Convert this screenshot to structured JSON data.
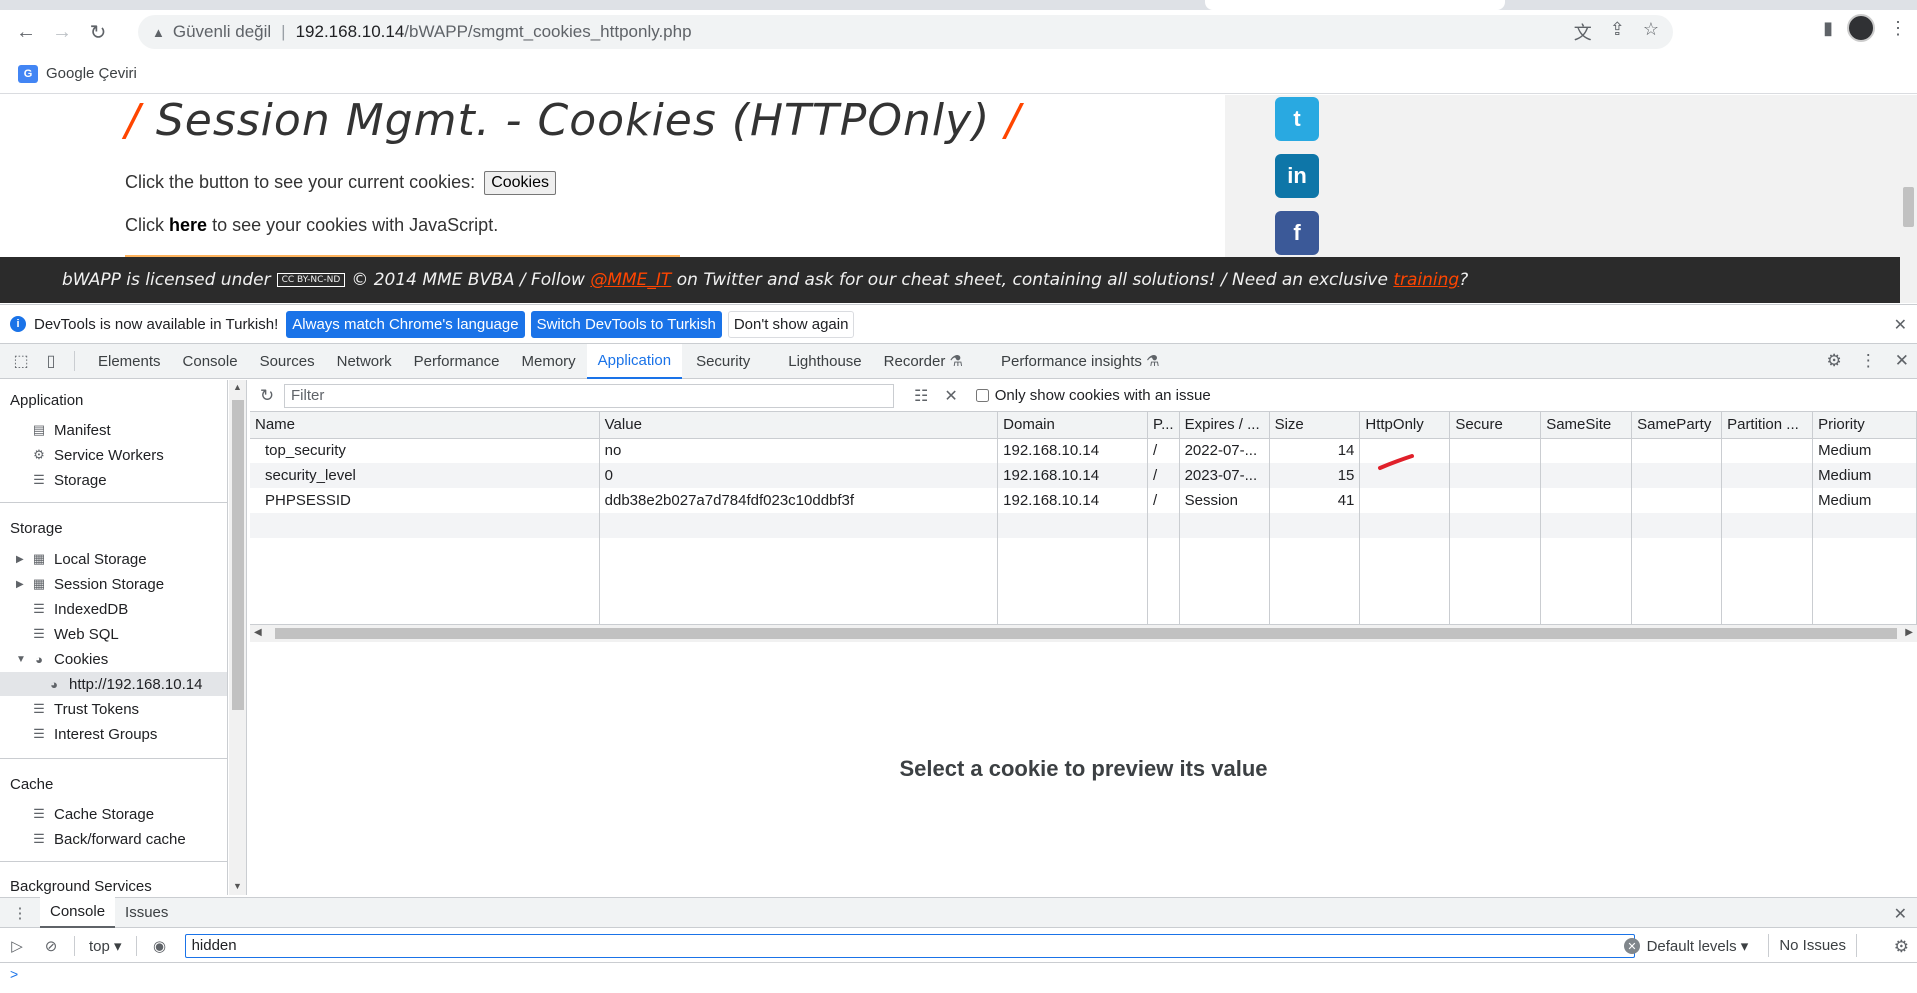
{
  "browser": {
    "security_label": "Güvenli değil",
    "separator": "|",
    "url_host": "192.168.10.14",
    "url_path": "/bWAPP/smgmt_cookies_httponly.php",
    "bookmark": "Google Çeviri",
    "icons": [
      "back-icon",
      "forward-icon",
      "reload-icon",
      "warning-icon",
      "translate-icon",
      "share-icon",
      "star-icon",
      "sidepanel-icon",
      "avatar",
      "menu-icon"
    ]
  },
  "page": {
    "title_slash_left": "/",
    "title": "Session Mgmt. - Cookies (HTTPOnly)",
    "title_slash_right": "/",
    "line1_text": "Click the button to see your current cookies:",
    "cookies_button": "Cookies",
    "line2_pre": "Click",
    "line2_link": "here",
    "line2_post": "to see your cookies with JavaScript.",
    "social": {
      "twitter": "t",
      "linkedin": "in",
      "facebook": "f"
    },
    "footer": {
      "pre": "bWAPP is licensed under",
      "cc": "CC BY-NC-ND",
      "mid": "© 2014 MME BVBA / Follow",
      "handle": "@MME_IT",
      "post": "on Twitter and ask for our cheat sheet, containing all solutions! / Need an exclusive",
      "training": "training",
      "end": "?"
    }
  },
  "infobar": {
    "message": "DevTools is now available in Turkish!",
    "btn_match": "Always match Chrome's language",
    "btn_switch": "Switch DevTools to Turkish",
    "btn_dismiss": "Don't show again"
  },
  "devtools": {
    "tabs": [
      "Elements",
      "Console",
      "Sources",
      "Network",
      "Performance",
      "Memory",
      "Application",
      "Security",
      "Lighthouse",
      "Recorder",
      "Performance insights"
    ],
    "active_tab": "Application",
    "experimental_mark": "⚗"
  },
  "sidebar": {
    "application_head": "Application",
    "application_items": [
      "Manifest",
      "Service Workers",
      "Storage"
    ],
    "storage_head": "Storage",
    "storage_items": [
      "Local Storage",
      "Session Storage",
      "IndexedDB",
      "Web SQL",
      "Cookies"
    ],
    "cookie_origin": "http://192.168.10.14",
    "storage_items_2": [
      "Trust Tokens",
      "Interest Groups"
    ],
    "cache_head": "Cache",
    "cache_items": [
      "Cache Storage",
      "Back/forward cache"
    ],
    "background_head": "Background Services"
  },
  "filter": {
    "placeholder": "Filter",
    "only_issues_label": "Only show cookies with an issue"
  },
  "cookies_table": {
    "columns": [
      "Name",
      "Value",
      "Domain",
      "P...",
      "Expires / ...",
      "Size",
      "HttpOnly",
      "Secure",
      "SameSite",
      "SameParty",
      "Partition ...",
      "Priority"
    ],
    "rows": [
      {
        "name": "top_security",
        "value": "no",
        "domain": "192.168.10.14",
        "path": "/",
        "expires": "2022-07-...",
        "size": "14",
        "httponly": "",
        "secure": "",
        "samesite": "",
        "sameparty": "",
        "partition": "",
        "priority": "Medium"
      },
      {
        "name": "security_level",
        "value": "0",
        "domain": "192.168.10.14",
        "path": "/",
        "expires": "2023-07-...",
        "size": "15",
        "httponly": "",
        "secure": "",
        "samesite": "",
        "sameparty": "",
        "partition": "",
        "priority": "Medium"
      },
      {
        "name": "PHPSESSID",
        "value": "ddb38e2b027a7d784fdf023c10ddbf3f",
        "domain": "192.168.10.14",
        "path": "/",
        "expires": "Session",
        "size": "41",
        "httponly": "",
        "secure": "",
        "samesite": "",
        "sameparty": "",
        "partition": "",
        "priority": "Medium"
      }
    ]
  },
  "preview": {
    "message": "Select a cookie to preview its value"
  },
  "drawer": {
    "tabs": [
      "Console",
      "Issues"
    ],
    "active_tab": "Console",
    "context": "top",
    "filter_value": "hidden",
    "levels": "Default levels",
    "issues": "No Issues",
    "prompt": ">"
  },
  "colors": {
    "accent": "#1a73e8",
    "bwapp_orange": "#ff4500",
    "footer_bg": "#2b2b2b",
    "annotation_red": "#e0202a"
  }
}
